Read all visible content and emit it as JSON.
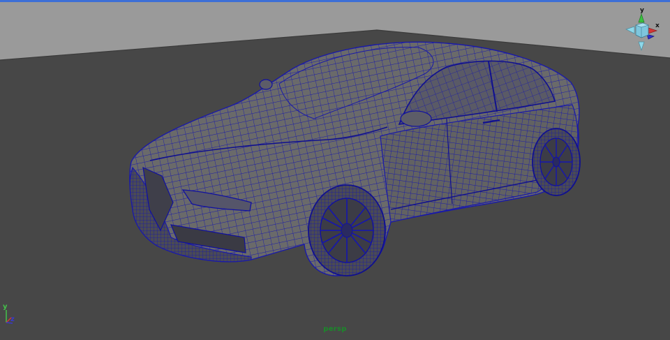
{
  "viewport": {
    "camera_name": "persp"
  },
  "view_cube": {
    "y_label": "y",
    "x_label": "x",
    "icon": "view-cube-icon"
  },
  "axis_indicator": {
    "y_label": "y",
    "z_label": "z",
    "icon": "axis-triad-icon"
  },
  "colors": {
    "background": "#555555",
    "floor": "#464646",
    "wall": "#9a9a9a",
    "wireframe": "#1a1aa8",
    "active_border": "#3d6fd6",
    "camera_label": "#1a8a2a"
  }
}
